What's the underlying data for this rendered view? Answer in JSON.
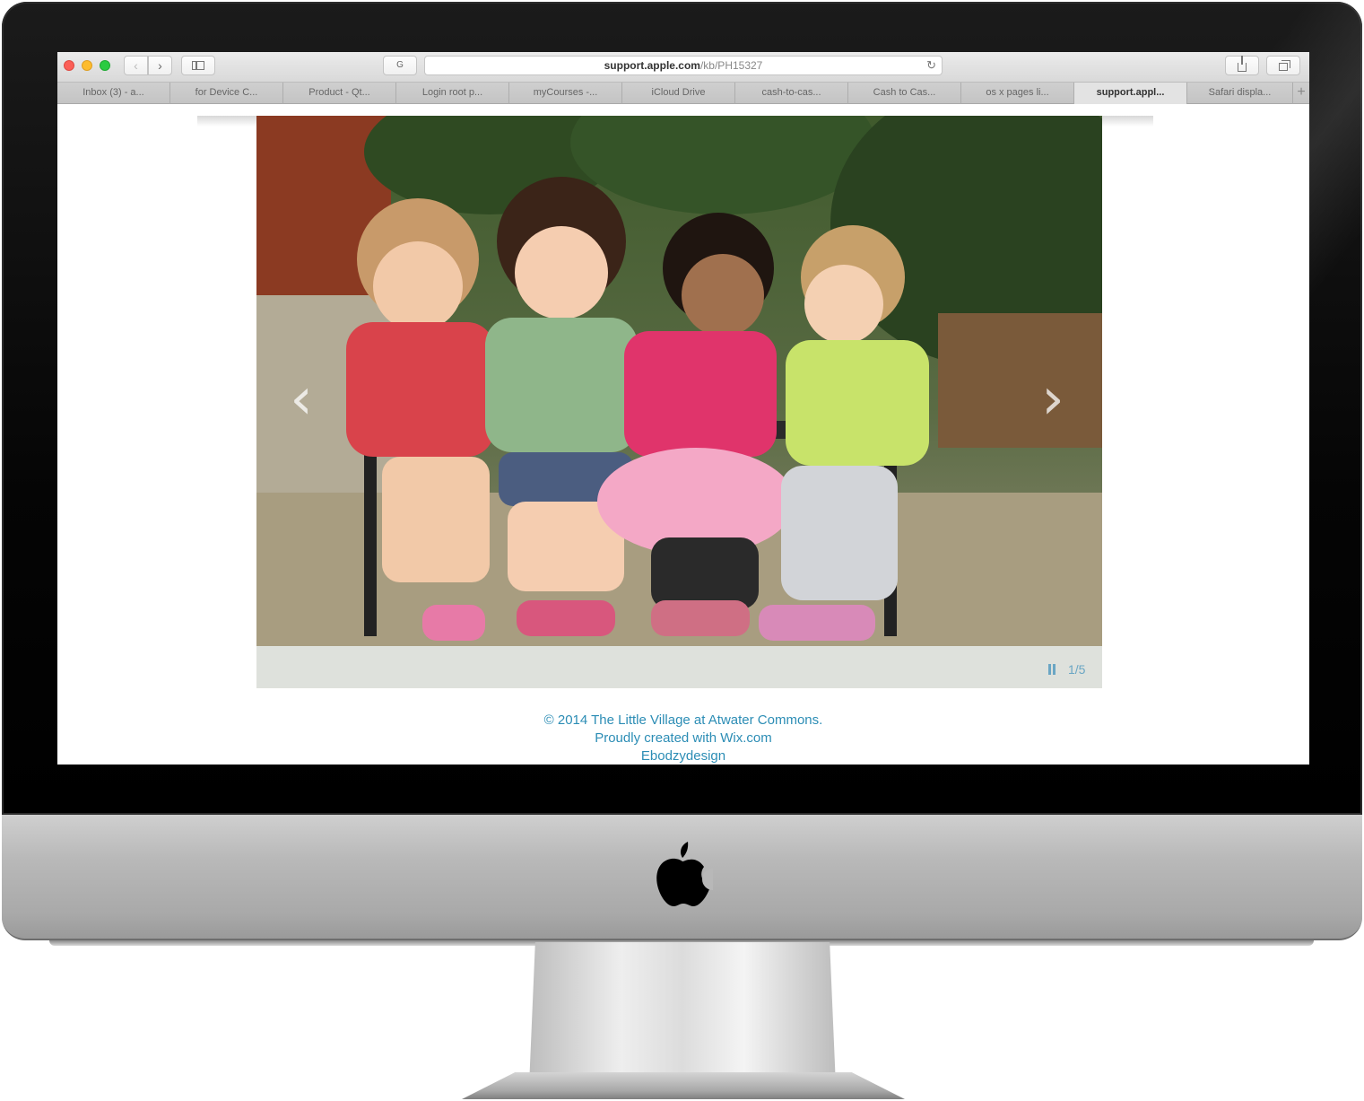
{
  "browser": {
    "address": {
      "host": "support.apple.com",
      "path": "/kb/PH15327",
      "reader_label": "G",
      "reload_icon": "reload-icon"
    },
    "tabs": [
      {
        "label": "Inbox (3) - a..."
      },
      {
        "label": "for Device C..."
      },
      {
        "label": "Product - Qt..."
      },
      {
        "label": "Login root p..."
      },
      {
        "label": "myCourses -..."
      },
      {
        "label": "iCloud Drive"
      },
      {
        "label": "cash-to-cas..."
      },
      {
        "label": "Cash to Cas..."
      },
      {
        "label": "os x pages li..."
      },
      {
        "label": "support.appl...",
        "active": true
      },
      {
        "label": "Safari displa..."
      }
    ],
    "new_tab_label": "+",
    "colors": {
      "close": "#fb5f57",
      "minimize": "#fdbc2e",
      "zoom": "#2acb42"
    }
  },
  "slideshow": {
    "counter": "1/5",
    "prev_arrow": "‹",
    "next_arrow": "›",
    "accent": "#6aa6c4"
  },
  "footer": {
    "copyright": "© 2014 The Little Village at Atwater Commons.",
    "credit": "Proudly created with Wix.com",
    "designer": "Ebodzydesign",
    "color": "#2c8db5"
  }
}
